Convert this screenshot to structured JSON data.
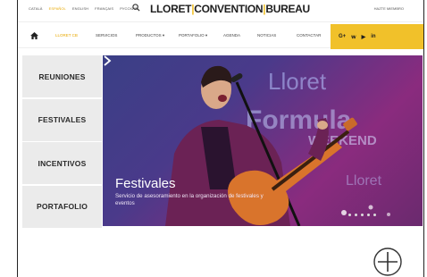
{
  "languages": [
    {
      "label": "Català",
      "active": false
    },
    {
      "label": "Español",
      "active": true
    },
    {
      "label": "English",
      "active": false
    },
    {
      "label": "Français",
      "active": false
    },
    {
      "label": "Русский",
      "active": false
    }
  ],
  "logo": {
    "left": "LLORET",
    "mid": "CONVENTION",
    "right": "BUREAU"
  },
  "member_link": "Hazte miembro",
  "nav": [
    {
      "label": "Lloret CB",
      "active": true
    },
    {
      "label": "Servicios",
      "active": false
    },
    {
      "label": "Productos ▾",
      "active": false
    },
    {
      "label": "Portafolio ▾",
      "active": false
    },
    {
      "label": "Agenda",
      "active": false
    },
    {
      "label": "Noticias",
      "active": false
    },
    {
      "label": "Contactar",
      "active": false
    }
  ],
  "social": [
    "G+",
    "𝕨",
    "▶",
    "in"
  ],
  "side_menu": [
    "Reuniones",
    "Festivales",
    "Incentivos",
    "Portafolio"
  ],
  "hero": {
    "title": "Festivales",
    "subtitle": "Servicio de asesoramiento en la organización de festivales y eventos",
    "background_words": [
      "Lloret",
      "Formula",
      "WEEKEND",
      "Lloret"
    ]
  },
  "colors": {
    "accent": "#f1c12a",
    "active_text": "#e8a800",
    "menu_bg": "#ebebeb"
  }
}
